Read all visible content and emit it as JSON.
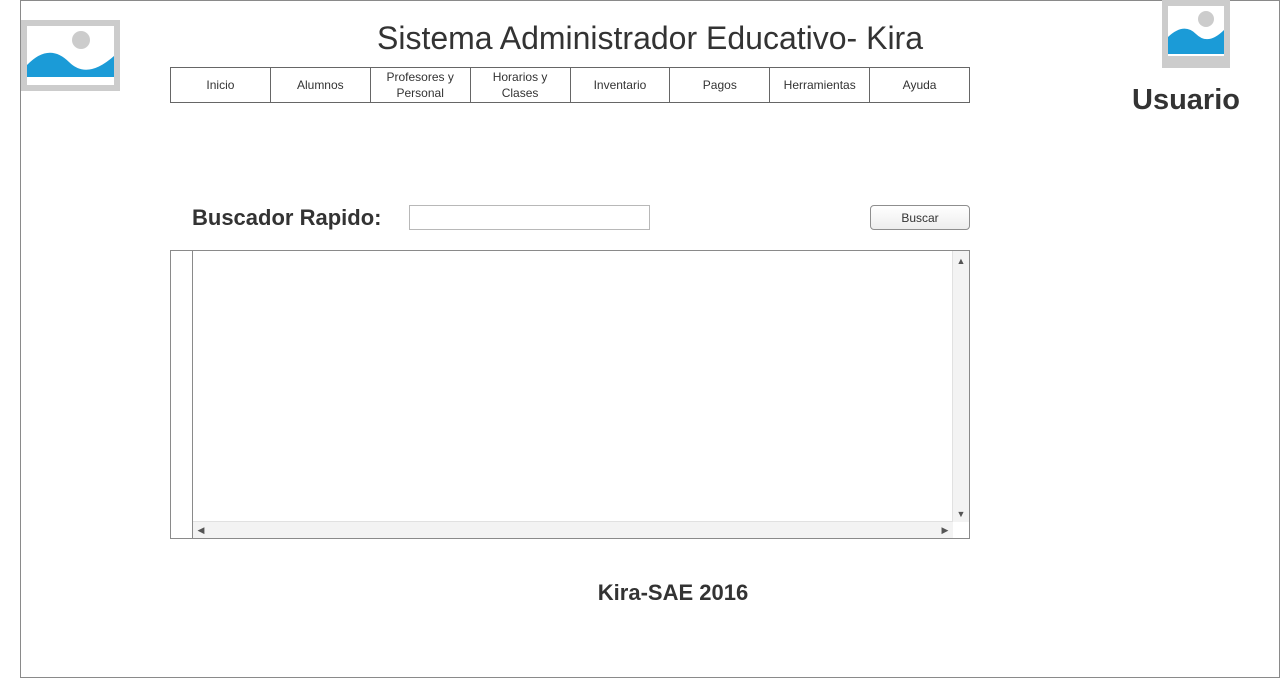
{
  "header": {
    "title": "Sistema Administrador Educativo- Kira",
    "user_label": "Usuario",
    "logo_icon": "image-placeholder-icon",
    "avatar_icon": "image-placeholder-icon"
  },
  "menu": {
    "items": [
      {
        "label": "Inicio"
      },
      {
        "label": "Alumnos"
      },
      {
        "label": "Profesores y Personal"
      },
      {
        "label": "Horarios y Clases"
      },
      {
        "label": "Inventario"
      },
      {
        "label": "Pagos"
      },
      {
        "label": "Herramientas"
      },
      {
        "label": "Ayuda"
      }
    ]
  },
  "search": {
    "label": "Buscador Rapido:",
    "value": "",
    "placeholder": "",
    "button_label": "Buscar"
  },
  "results_grid": {
    "rows": [],
    "scroll_arrows": {
      "up": "▲",
      "down": "▼",
      "left": "◀",
      "right": "▶"
    }
  },
  "footer": {
    "text": "Kira-SAE 2016"
  },
  "colors": {
    "placeholder_bg": "#cccccc",
    "placeholder_image": "#1b9bd7",
    "text": "#333333",
    "border": "#666666"
  }
}
